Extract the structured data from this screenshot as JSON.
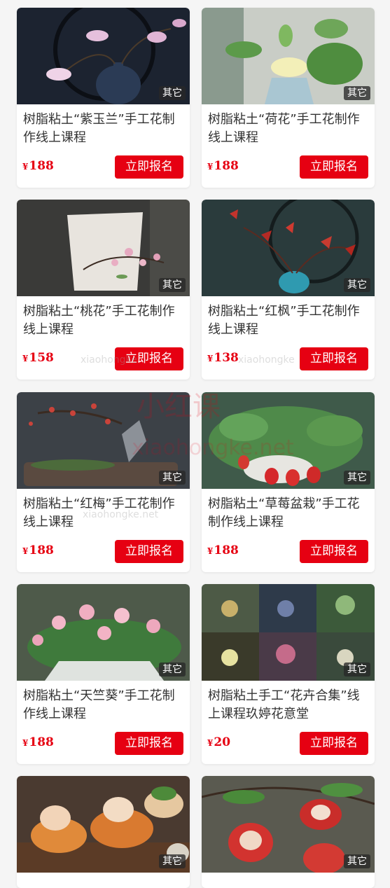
{
  "products": [
    {
      "title": "树脂粘土“紫玉兰”手工花制作线上课程",
      "currency": "¥",
      "price": "188",
      "badge": "其它",
      "cta": "立即报名"
    },
    {
      "title": "树脂粘土“荷花”手工花制作线上课程",
      "currency": "¥",
      "price": "188",
      "badge": "其它",
      "cta": "立即报名"
    },
    {
      "title": "树脂粘土“桃花”手工花制作线上课程",
      "currency": "¥",
      "price": "158",
      "badge": "其它",
      "cta": "立即报名"
    },
    {
      "title": "树脂粘土“红枫”手工花制作线上课程",
      "currency": "¥",
      "price": "138",
      "badge": "其它",
      "cta": "立即报名"
    },
    {
      "title": "树脂粘土“红梅”手工花制作线上课程",
      "currency": "¥",
      "price": "188",
      "badge": "其它",
      "cta": "立即报名"
    },
    {
      "title": "树脂粘土“草莓盆栽”手工花制作线上课程",
      "currency": "¥",
      "price": "188",
      "badge": "其它",
      "cta": "立即报名"
    },
    {
      "title": "树脂粘土“天竺葵”手工花制作线上课程",
      "currency": "¥",
      "price": "188",
      "badge": "其它",
      "cta": "立即报名"
    },
    {
      "title": "树脂粘土手工“花卉合集”线上课程玖婷花意堂",
      "currency": "¥",
      "price": "20",
      "badge": "其它",
      "cta": "立即报名"
    },
    {
      "badge": "其它"
    },
    {
      "badge": "其它"
    }
  ],
  "watermark": {
    "brand": "小红课",
    "domain": "xiaohongke.net",
    "domain_short": "xiaohongke"
  },
  "colors": {
    "accent": "#e60012"
  }
}
